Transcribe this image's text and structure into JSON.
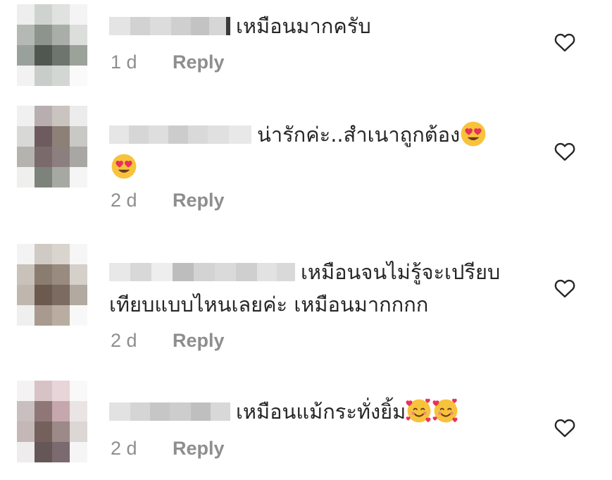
{
  "comments": [
    {
      "username_hidden": true,
      "text": "เหมือนมากครับ",
      "text_line2": "",
      "emojis": [],
      "time": "1 d",
      "reply": "Reply",
      "heart_icon": "heart-outline-icon"
    },
    {
      "username_hidden": true,
      "text": "น่ารักค่ะ..สำเนาถูกต้อง",
      "text_line2": "",
      "emojis": [
        "smiling-face-with-heart-eyes",
        "smiling-face-with-heart-eyes"
      ],
      "time": "2 d",
      "reply": "Reply",
      "heart_icon": "heart-outline-icon"
    },
    {
      "username_hidden": true,
      "text": "เหมือนจนไม่รู้จะเปรียบ",
      "text_line2": "เทียบแบบไหนเลยค่ะ เหมือนมากกกก",
      "emojis": [],
      "time": "2 d",
      "reply": "Reply",
      "heart_icon": "heart-outline-icon"
    },
    {
      "username_hidden": true,
      "text": "เหมือนแม้กระทั่งยิ้ม",
      "text_line2": "",
      "emojis": [
        "smiling-face-with-hearts",
        "smiling-face-with-hearts"
      ],
      "time": "2 d",
      "reply": "Reply",
      "heart_icon": "heart-outline-icon"
    }
  ],
  "colors": {
    "text": "#262626",
    "meta": "#8e8e8e",
    "heart_stroke": "#262626",
    "emoji_face": "#f7c33b",
    "emoji_heart": "#e8315b"
  }
}
